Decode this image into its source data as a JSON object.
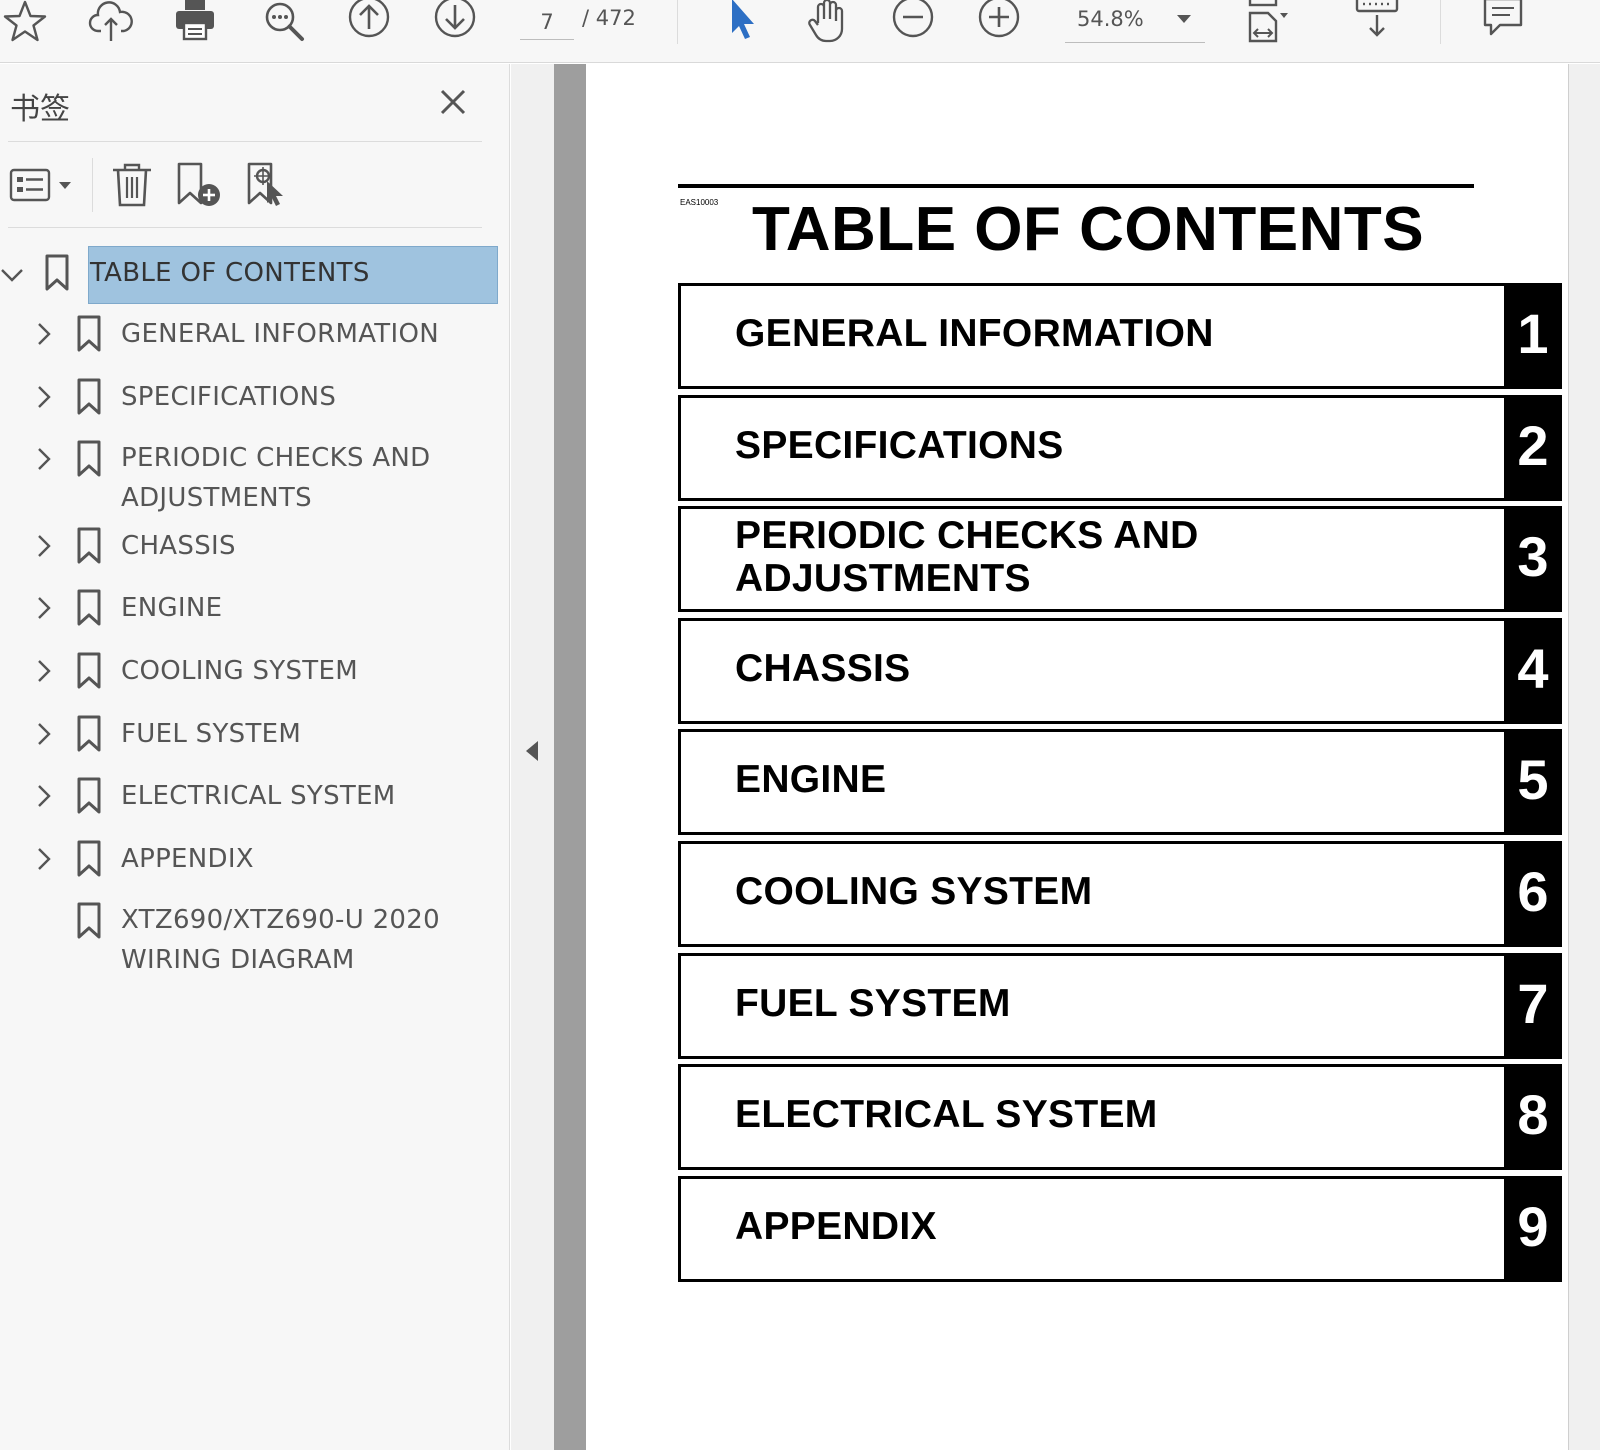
{
  "toolbar": {
    "current_page": "7",
    "page_total": "/ 472",
    "zoom": "54.8%",
    "icons": [
      "star-icon",
      "cloud-upload-icon",
      "print-icon",
      "search-zoom-icon",
      "page-up-icon",
      "page-down-icon",
      "select-cursor-icon",
      "hand-tool-icon",
      "zoom-out-icon",
      "zoom-in-icon",
      "fit-page-icon",
      "scroll-mode-icon",
      "comment-icon"
    ]
  },
  "bookmarks": {
    "title": "书签",
    "items": [
      {
        "label": "TABLE OF CONTENTS",
        "expanded": true,
        "selected": true
      },
      {
        "label": "GENERAL INFORMATION"
      },
      {
        "label": "SPECIFICATIONS"
      },
      {
        "label_line1": "PERIODIC CHECKS AND",
        "label_line2": "ADJUSTMENTS"
      },
      {
        "label": "CHASSIS"
      },
      {
        "label": "ENGINE"
      },
      {
        "label": "COOLING SYSTEM"
      },
      {
        "label": "FUEL SYSTEM"
      },
      {
        "label": "ELECTRICAL SYSTEM"
      },
      {
        "label": "APPENDIX"
      },
      {
        "label_line1": "XTZ690/XTZ690-U 2020",
        "label_line2": "WIRING DIAGRAM"
      }
    ]
  },
  "document": {
    "code": "EAS10003",
    "title": "TABLE OF CONTENTS",
    "sections": [
      {
        "label": "GENERAL INFORMATION",
        "num": "1"
      },
      {
        "label": "SPECIFICATIONS",
        "num": "2"
      },
      {
        "label_line1": "PERIODIC CHECKS AND",
        "label_line2": "ADJUSTMENTS",
        "num": "3"
      },
      {
        "label": "CHASSIS",
        "num": "4"
      },
      {
        "label": "ENGINE",
        "num": "5"
      },
      {
        "label": "COOLING SYSTEM",
        "num": "6"
      },
      {
        "label": "FUEL SYSTEM",
        "num": "7"
      },
      {
        "label": "ELECTRICAL SYSTEM",
        "num": "8"
      },
      {
        "label": "APPENDIX",
        "num": "9"
      }
    ]
  },
  "colors": {
    "accent_blue": "#2d6fc4",
    "selection": "#9fc3df",
    "icon_gray": "#555555"
  }
}
